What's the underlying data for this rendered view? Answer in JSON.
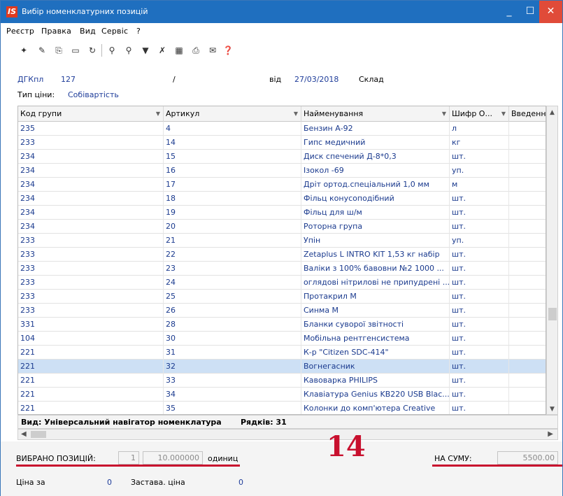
{
  "window": {
    "title": "Вибір номенклатурних позицій",
    "logo_text": "IS",
    "controls": {
      "minimize": "_",
      "maximize": "☐",
      "close": "✕"
    }
  },
  "menu": [
    "Реєстр",
    "Правка",
    "Вид",
    "Сервіс",
    "?"
  ],
  "header": {
    "doc_type": "ДГКпл",
    "doc_number": "127",
    "slash": "/",
    "date_label": "від",
    "date": "27/03/2018",
    "warehouse_label": "Склад",
    "price_type_label": "Тип ціни:",
    "price_type": "Собівартість"
  },
  "table": {
    "columns": [
      "Код групи",
      "Артикул",
      "Найменування",
      "Шифр О...",
      "Введення"
    ],
    "rows": [
      [
        "235",
        "4",
        "Бензин А-92",
        "л",
        ""
      ],
      [
        "233",
        "14",
        "Гипс медичний",
        "кг",
        ""
      ],
      [
        "234",
        "15",
        "Диск спечений Д-8*0,3",
        "шт.",
        ""
      ],
      [
        "234",
        "16",
        "Ізокол -69",
        "уп.",
        ""
      ],
      [
        "234",
        "17",
        "Дріт ортод.спеціальний 1,0 мм",
        "м",
        ""
      ],
      [
        "234",
        "18",
        "Фільц конусоподібний",
        "шт.",
        ""
      ],
      [
        "234",
        "19",
        "Фільц для ш/м",
        "шт.",
        ""
      ],
      [
        "234",
        "20",
        "Роторна група",
        "шт.",
        ""
      ],
      [
        "233",
        "21",
        "Упін",
        "уп.",
        ""
      ],
      [
        "233",
        "22",
        "Zetaplus L INTRO KIT 1,53 кг  набір",
        "шт.",
        ""
      ],
      [
        "233",
        "23",
        "Валіки з 100% бавовни №2 1000 ...",
        "шт.",
        ""
      ],
      [
        "233",
        "24",
        "оглядові нітрилові не припудрені ...",
        "шт.",
        ""
      ],
      [
        "233",
        "25",
        "Протакрил М",
        "шт.",
        ""
      ],
      [
        "233",
        "26",
        "Синма М",
        "шт.",
        ""
      ],
      [
        "331",
        "28",
        "Бланки суворої звітності",
        "шт.",
        ""
      ],
      [
        "104",
        "30",
        "Мобільна рентгенсистема",
        "шт.",
        ""
      ],
      [
        "221",
        "31",
        "К-р \"Citizen SDC-414\"",
        "шт.",
        ""
      ],
      [
        "221",
        "32",
        "Вогнегасник",
        "шт.",
        ""
      ],
      [
        "221",
        "33",
        "Кавоварка PHILIPS",
        "шт.",
        ""
      ],
      [
        "221",
        "34",
        "Клавіатура Genius KB220 USB Blac...",
        "шт.",
        ""
      ],
      [
        "221",
        "35",
        "Колонки до комп'ютера Creative",
        "шт.",
        ""
      ]
    ],
    "selected_row": 17
  },
  "footer": {
    "view_label": "Вид: Універсальний навігатор номенклатура",
    "rows_label": "Рядків: 31"
  },
  "summary": {
    "selected_label": "ВИБРАНО ПОЗИЦІЙ:",
    "positions_count": "1",
    "quantity": "10.000000",
    "units_label": "одиниц",
    "annotation": "14",
    "sum_label": "НА СУМУ:",
    "sum_value": "5500.00",
    "price_label": "Ціна за",
    "price_value": "0",
    "deposit_label": "Застава. ціна",
    "deposit_value": "0"
  },
  "colors": {
    "titlebar": "#1f6fbf",
    "selected_row": "#cde0f5",
    "accent_red": "#c8102e",
    "link_blue": "#1a3a8e"
  }
}
